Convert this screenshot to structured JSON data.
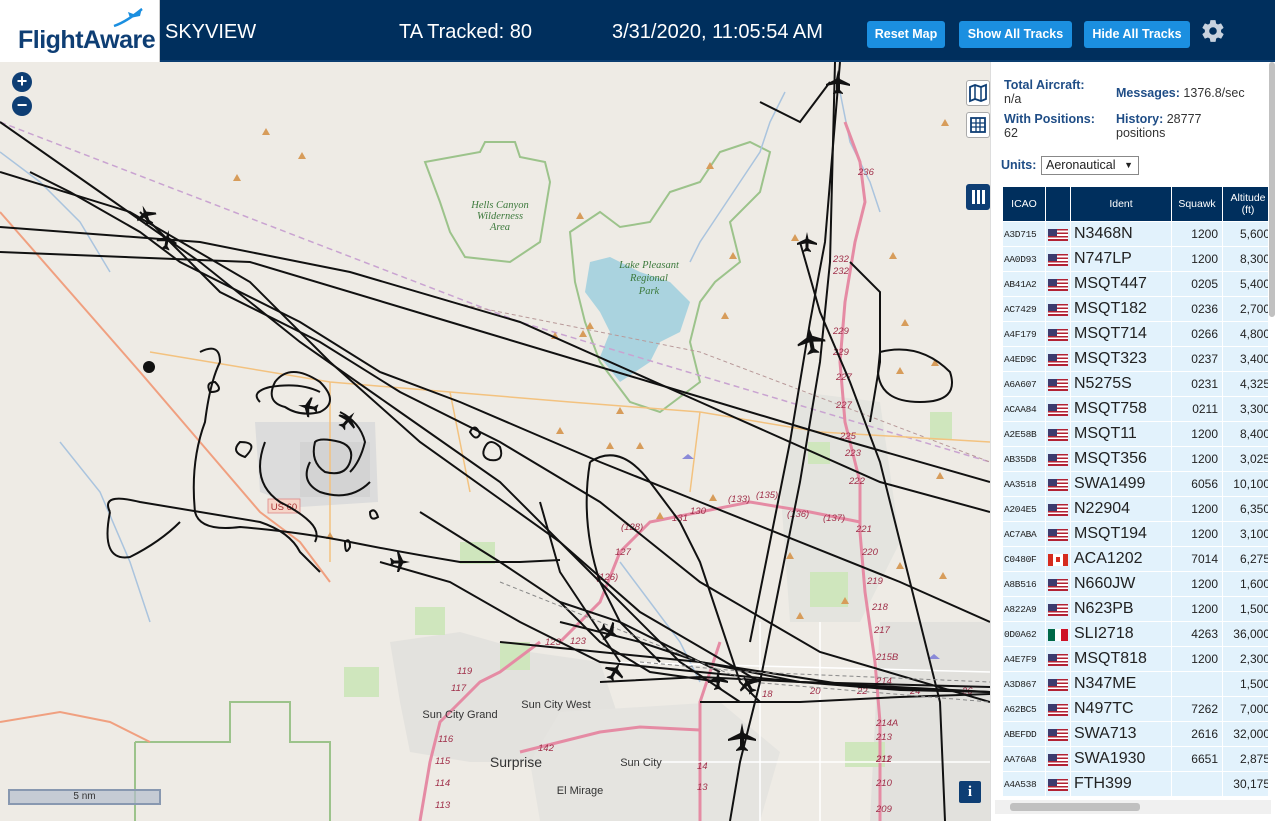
{
  "header": {
    "logo_text": "FlightAware",
    "app_title": "SKYVIEW",
    "tracked": "TA Tracked: 80",
    "datetime": "3/31/2020, 11:05:54 AM",
    "buttons": {
      "reset": "Reset Map",
      "show": "Show All Tracks",
      "hide": "Hide All Tracks"
    },
    "settings_icon": "gear-icon"
  },
  "map": {
    "zoom_in": "+",
    "zoom_out": "−",
    "scale_label": "5 nm",
    "info_label": "i",
    "place_labels": {
      "hells_canyon": [
        "Hells Canyon",
        "Wilderness",
        "Area"
      ],
      "lake_pleasant": [
        "Lake Pleasant",
        "Regional",
        "Park"
      ],
      "sun_city_grand": "Sun City Grand",
      "sun_city_west": "Sun City West",
      "surprise": "Surprise",
      "sun_city": "Sun City",
      "el_mirage": "El Mirage",
      "us60": "US 60"
    },
    "route_numbers": [
      "236",
      "232",
      "232",
      "229",
      "229",
      "227",
      "227",
      "225",
      "223",
      "222",
      "221",
      "220",
      "219",
      "218",
      "217",
      "215B",
      "214",
      "214A",
      "213",
      "212",
      "211",
      "210",
      "209",
      "(133)",
      "(135)",
      "(136)",
      "(137)",
      "131",
      "130",
      "(128)",
      "127",
      "(126)",
      "123",
      "123",
      "119",
      "117",
      "116",
      "115",
      "114",
      "113",
      "142",
      "14",
      "13",
      "18",
      "20",
      "22",
      "24",
      "26"
    ]
  },
  "panel": {
    "total_aircraft_label": "Total Aircraft:",
    "total_aircraft_value": "n/a",
    "with_positions_label": "With Positions:",
    "with_positions_value": "62",
    "messages_label": "Messages:",
    "messages_value": "1376.8/sec",
    "history_label": "History:",
    "history_value": "28777",
    "history_unit": "positions",
    "units_label": "Units:",
    "units_value": "Aeronautical",
    "columns": {
      "icao": "ICAO",
      "flag": "",
      "ident": "Ident",
      "squawk": "Squawk",
      "altitude": "Altitude",
      "altitude_unit": "(ft)"
    },
    "rows": [
      {
        "icao": "A3D715",
        "flag": "us",
        "ident": "N3468N",
        "squawk": "1200",
        "altitude": "5,600"
      },
      {
        "icao": "AA0D93",
        "flag": "us",
        "ident": "N747LP",
        "squawk": "1200",
        "altitude": "8,300"
      },
      {
        "icao": "AB41A2",
        "flag": "us",
        "ident": "MSQT447",
        "squawk": "0205",
        "altitude": "5,400"
      },
      {
        "icao": "AC7429",
        "flag": "us",
        "ident": "MSQT182",
        "squawk": "0236",
        "altitude": "2,700"
      },
      {
        "icao": "A4F179",
        "flag": "us",
        "ident": "MSQT714",
        "squawk": "0266",
        "altitude": "4,800"
      },
      {
        "icao": "A4ED9C",
        "flag": "us",
        "ident": "MSQT323",
        "squawk": "0237",
        "altitude": "3,400"
      },
      {
        "icao": "A6A607",
        "flag": "us",
        "ident": "N5275S",
        "squawk": "0231",
        "altitude": "4,325"
      },
      {
        "icao": "ACAA84",
        "flag": "us",
        "ident": "MSQT758",
        "squawk": "0211",
        "altitude": "3,300"
      },
      {
        "icao": "A2E58B",
        "flag": "us",
        "ident": "MSQT11",
        "squawk": "1200",
        "altitude": "8,400"
      },
      {
        "icao": "AB35D8",
        "flag": "us",
        "ident": "MSQT356",
        "squawk": "1200",
        "altitude": "3,025"
      },
      {
        "icao": "AA3518",
        "flag": "us",
        "ident": "SWA1499",
        "squawk": "6056",
        "altitude": "10,100"
      },
      {
        "icao": "A204E5",
        "flag": "us",
        "ident": "N22904",
        "squawk": "1200",
        "altitude": "6,350"
      },
      {
        "icao": "AC7ABA",
        "flag": "us",
        "ident": "MSQT194",
        "squawk": "1200",
        "altitude": "3,100"
      },
      {
        "icao": "C0480F",
        "flag": "ca",
        "ident": "ACA1202",
        "squawk": "7014",
        "altitude": "6,275"
      },
      {
        "icao": "A8B516",
        "flag": "us",
        "ident": "N660JW",
        "squawk": "1200",
        "altitude": "1,600"
      },
      {
        "icao": "A822A9",
        "flag": "us",
        "ident": "N623PB",
        "squawk": "1200",
        "altitude": "1,500"
      },
      {
        "icao": "0D0A62",
        "flag": "mx",
        "ident": "SLI2718",
        "squawk": "4263",
        "altitude": "36,000"
      },
      {
        "icao": "A4E7F9",
        "flag": "us",
        "ident": "MSQT818",
        "squawk": "1200",
        "altitude": "2,300"
      },
      {
        "icao": "A3D867",
        "flag": "us",
        "ident": "N347ME",
        "squawk": "",
        "altitude": "1,500"
      },
      {
        "icao": "A62BC5",
        "flag": "us",
        "ident": "N497TC",
        "squawk": "7262",
        "altitude": "7,000"
      },
      {
        "icao": "ABEFDD",
        "flag": "us",
        "ident": "SWA713",
        "squawk": "2616",
        "altitude": "32,000"
      },
      {
        "icao": "AA76A8",
        "flag": "us",
        "ident": "SWA1930",
        "squawk": "6651",
        "altitude": "2,875"
      },
      {
        "icao": "A4A538",
        "flag": "us",
        "ident": "FTH399",
        "squawk": "",
        "altitude": "30,175"
      }
    ]
  },
  "colors": {
    "header_bg": "#002f5d",
    "button_bg": "#1b8fe0",
    "row_bg": "#e2f2fc",
    "map_bg": "#eeebe5",
    "park_border": "#9cc38b",
    "highway": "#e58ba4",
    "track": "#111111"
  }
}
